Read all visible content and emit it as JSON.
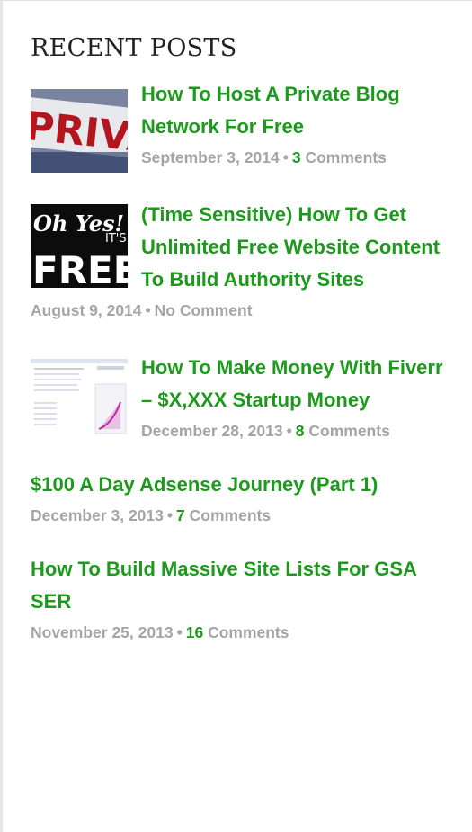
{
  "widget": {
    "title": "RECENT POSTS"
  },
  "posts": [
    {
      "title": "How To Host A Private Blog Network For Free",
      "date": "September 3, 2014",
      "separator": "•",
      "count": "3",
      "comments_label": "Comments",
      "thumb": "private-sign"
    },
    {
      "title": "(Time Sensitive) How To Get Unlimited Free Website Content To Build Authority Sites",
      "date": "August 9, 2014",
      "separator": "•",
      "comment_text": "No Comment",
      "thumb": "oh-yes-free"
    },
    {
      "title": "How To Make Money With Fiverr – $X,XXX Startup Money",
      "date": "December 28, 2013",
      "separator": "•",
      "count": "8",
      "comments_label": "Comments",
      "thumb": "spreadsheet-screenshot"
    },
    {
      "title": "$100 A Day Adsense Journey (Part 1)",
      "date": "December 3, 2013",
      "separator": "•",
      "count": "7",
      "comments_label": "Comments"
    },
    {
      "title": "How To Build Massive Site Lists For GSA SER",
      "date": "November 25, 2013",
      "separator": "•",
      "count": "16",
      "comments_label": "Comments"
    }
  ],
  "thumb_text": {
    "private": "PRIVA",
    "ohyes": "Oh Yes!",
    "its": "IT'S",
    "free": "FREE"
  }
}
